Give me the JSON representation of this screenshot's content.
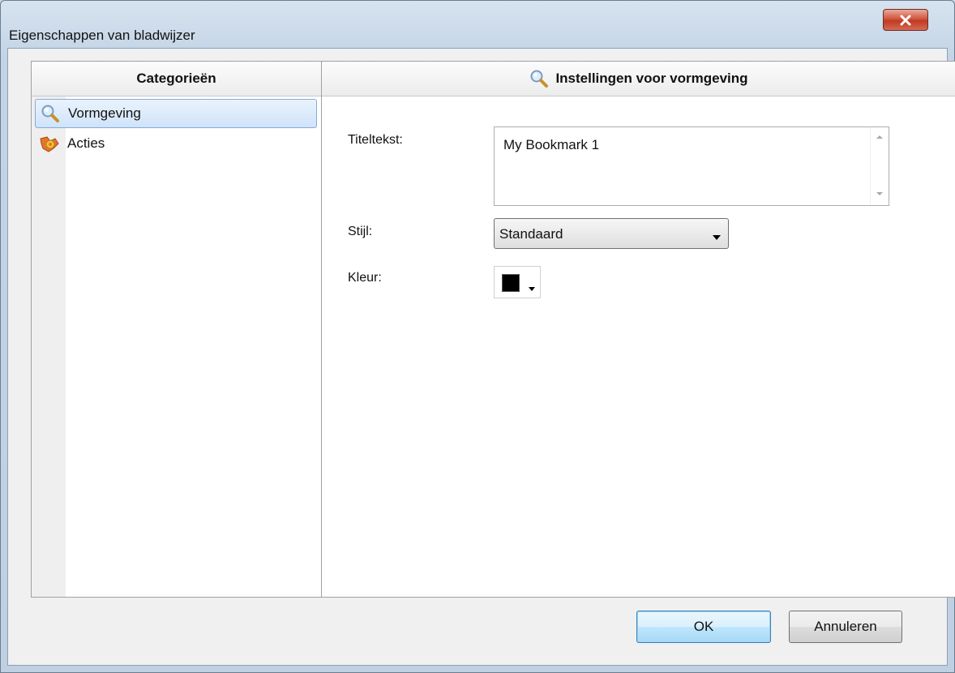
{
  "window": {
    "title": "Eigenschappen van bladwijzer"
  },
  "left_panel": {
    "header": "Categorieën",
    "items": [
      {
        "label": "Vormgeving",
        "icon": "magnifier-icon",
        "selected": true
      },
      {
        "label": "Acties",
        "icon": "actions-gear-icon",
        "selected": false
      }
    ]
  },
  "right_panel": {
    "header": "Instellingen voor vormgeving",
    "header_icon": "magnifier-icon",
    "title_label": "Titeltekst:",
    "title_value": "My Bookmark 1",
    "style_label": "Stijl:",
    "style_value": "Standaard",
    "color_label": "Kleur:",
    "color_value": "#000000"
  },
  "buttons": {
    "ok": "OK",
    "cancel": "Annuleren"
  },
  "colors": {
    "selection_bg": "#cfe3f9",
    "close_button": "#c13a22"
  }
}
